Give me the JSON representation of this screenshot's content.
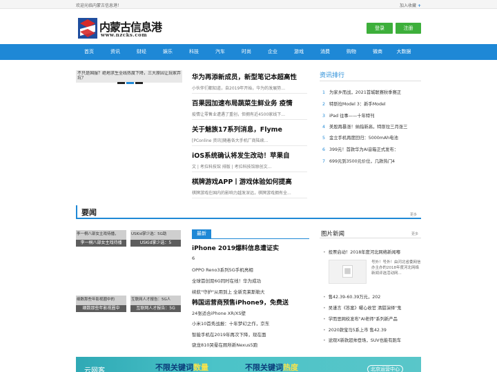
{
  "topbar": {
    "welcome": "欢迎光临内蒙古信息港！",
    "favorite": "加入收藏",
    "favorite_icon": "plus-icon"
  },
  "logo": {
    "name": "内蒙古信息港",
    "url": "www.nzcks.com"
  },
  "auth": {
    "login": "登录",
    "register": "注册"
  },
  "nav": [
    "首页",
    "资讯",
    "财经",
    "娱乐",
    "科技",
    "汽车",
    "时尚",
    "企业",
    "游戏",
    "消费",
    "购物",
    "微商",
    "大数据"
  ],
  "slider": {
    "broken_alt": "不只是国服？绝地求生全线热度下降，三大原因让玩家弃坑？"
  },
  "news": [
    {
      "title": "华为再添新成员，新型笔记本超高性",
      "desc": "小伙伴们都知道，自2019年开始，华为的发展势..."
    },
    {
      "title": "百果园加速布局蔬菜生鲜业务 疫情",
      "desc": "疫情让零售业遭遇了重创，但拥有近4500家线下..."
    },
    {
      "title": "关于魅族17系列消息，Flyme",
      "desc": "[PConline 资讯]随着各大手机厂商陆续..."
    },
    {
      "title": "iOS系统确认将发生改动！苹果自",
      "desc": "文 | 考拉科技馆 排版 | 考拉科技馆原创文..."
    },
    {
      "title": "棋牌游戏APP丨游戏体验如何提高",
      "desc": "棋牌游戏在国内的影响力越发深远，棋牌游戏拥有全..."
    }
  ],
  "rank": {
    "title": "资讯排行",
    "items": [
      "为家乡而战，2021首城联赛秋季赛正",
      "特斯拉Model 3：新手Model",
      "iPad 往事——十年特刊",
      "美股再暴涨！纳指新高，特斯拉三月涨三",
      "金立手机再度回归：5000mAh电池",
      "399元！首款华为AI音箱正式发布：",
      "699元到3500元价位，几款热门4"
    ]
  },
  "section": {
    "title": "要闻",
    "more": "更多"
  },
  "thumbs": [
    {
      "alt": "李一桐八部女主戏待播，",
      "cap": "李一桐八部女主戏待播"
    },
    {
      "alt": "USKid掌少选：5G助",
      "cap": "USKid掌少选：5"
    },
    {
      "alt": "细数那些年影视圈中的",
      "cap": "细数那些年影视圈中"
    },
    {
      "alt": "互联网人才报告：5G人",
      "cap": "互联网人才报告：5G"
    }
  ],
  "latest": {
    "tab": "最新",
    "items": [
      {
        "text": "iPhone 2019爆料信息遭证实",
        "big": true
      },
      {
        "text": "6",
        "big": false
      },
      {
        "text": "OPPO Reno3系列5G手机亮相",
        "big": false
      },
      {
        "text": "全球首创双6G同时在线！华为成功",
        "big": false
      },
      {
        "text": "续航\"守护\"从用到上 全新克莱斯勒大",
        "big": false
      },
      {
        "text": "韩国运营商预售iPhone9，免费送",
        "big": true
      },
      {
        "text": "24张适合iPhone XR/XS壁",
        "big": false
      },
      {
        "text": "小米10首秀战报：十年梦幻之作，京东",
        "big": false
      },
      {
        "text": "智能手机在2019年再次下降，现在面",
        "big": false
      },
      {
        "text": "骁龙810哭晕在厕所新Nexus5跑",
        "big": false
      }
    ]
  },
  "pics": {
    "title": "图片新闻",
    "more": "更多",
    "headline": "投票启动！2018年度河北网络新闻嘟",
    "desc": "号外！号外！由河北省委网信办主办的2018年度河北网络新闻评选活动网...",
    "items": [
      "售42.39-60.39万元，202",
      "吴谨言《答案》曜心收官 清甜演绎\"鬼",
      "学而思网校发布\"AI老师\"系列新产品",
      "2020款宝马5系上市 售42.39",
      "途观X新款超帅登场，SUV也能有跑车"
    ]
  },
  "banner": {
    "brand": "云网客",
    "part1": "不限关键词",
    "hl1": "数量",
    "part2": "不限关键词",
    "hl2": "热度",
    "operator": "北京运营中心"
  },
  "colors": {
    "nav": "#1e88d6",
    "accent_green": "#3daf3b",
    "logo_blue": "#1f4d9e",
    "logo_red": "#d62a2a"
  }
}
